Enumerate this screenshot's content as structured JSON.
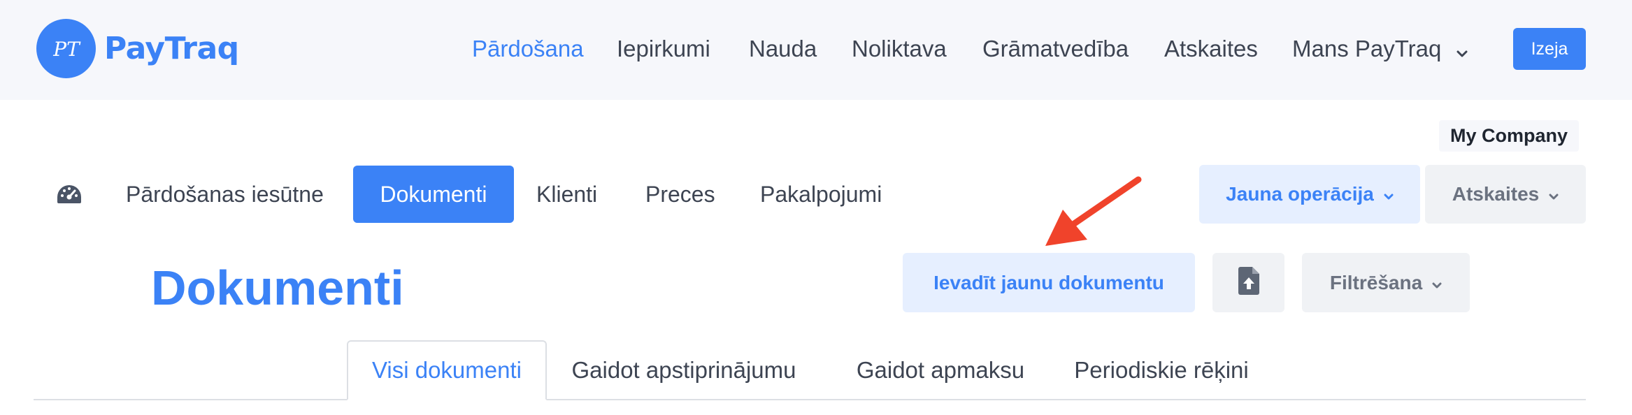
{
  "brand": {
    "name": "PayTraq",
    "monogram": "PT"
  },
  "mainnav": {
    "items": [
      {
        "label": "Pārdošana",
        "active": true
      },
      {
        "label": "Iepirkumi"
      },
      {
        "label": "Nauda"
      },
      {
        "label": "Noliktava"
      },
      {
        "label": "Grāmatvedība"
      },
      {
        "label": "Atskaites"
      },
      {
        "label": "Mans PayTraq",
        "dropdown": true
      }
    ],
    "logout_label": "Izeja"
  },
  "company": "My Company",
  "subnav": {
    "items": [
      {
        "label": "Pārdošanas iesūtne"
      },
      {
        "label": "Dokumenti",
        "active": true
      },
      {
        "label": "Klienti"
      },
      {
        "label": "Preces"
      },
      {
        "label": "Pakalpojumi"
      }
    ],
    "new_operation_label": "Jauna operācija",
    "reports_label": "Atskaites"
  },
  "page": {
    "title": "Dokumenti",
    "enter_new_label": "Ievadīt jaunu dokumentu",
    "filter_label": "Filtrēšana"
  },
  "tabs": [
    {
      "label": "Visi dokumenti",
      "active": true
    },
    {
      "label": "Gaidot apstiprinājumu"
    },
    {
      "label": "Gaidot apmaksu"
    },
    {
      "label": "Periodiskie rēķini"
    }
  ],
  "colors": {
    "accent": "#3b82f6",
    "accent_light": "#e6efff",
    "navbar_bg": "#f6f7fb",
    "button_gray": "#f0f2f5",
    "annotation_arrow": "#f0432b"
  },
  "icons": {
    "dashboard": "speedometer-icon",
    "upload": "file-upload-icon",
    "dropdown": "chevron-down-icon",
    "annotation": "red-arrow-pointer"
  }
}
